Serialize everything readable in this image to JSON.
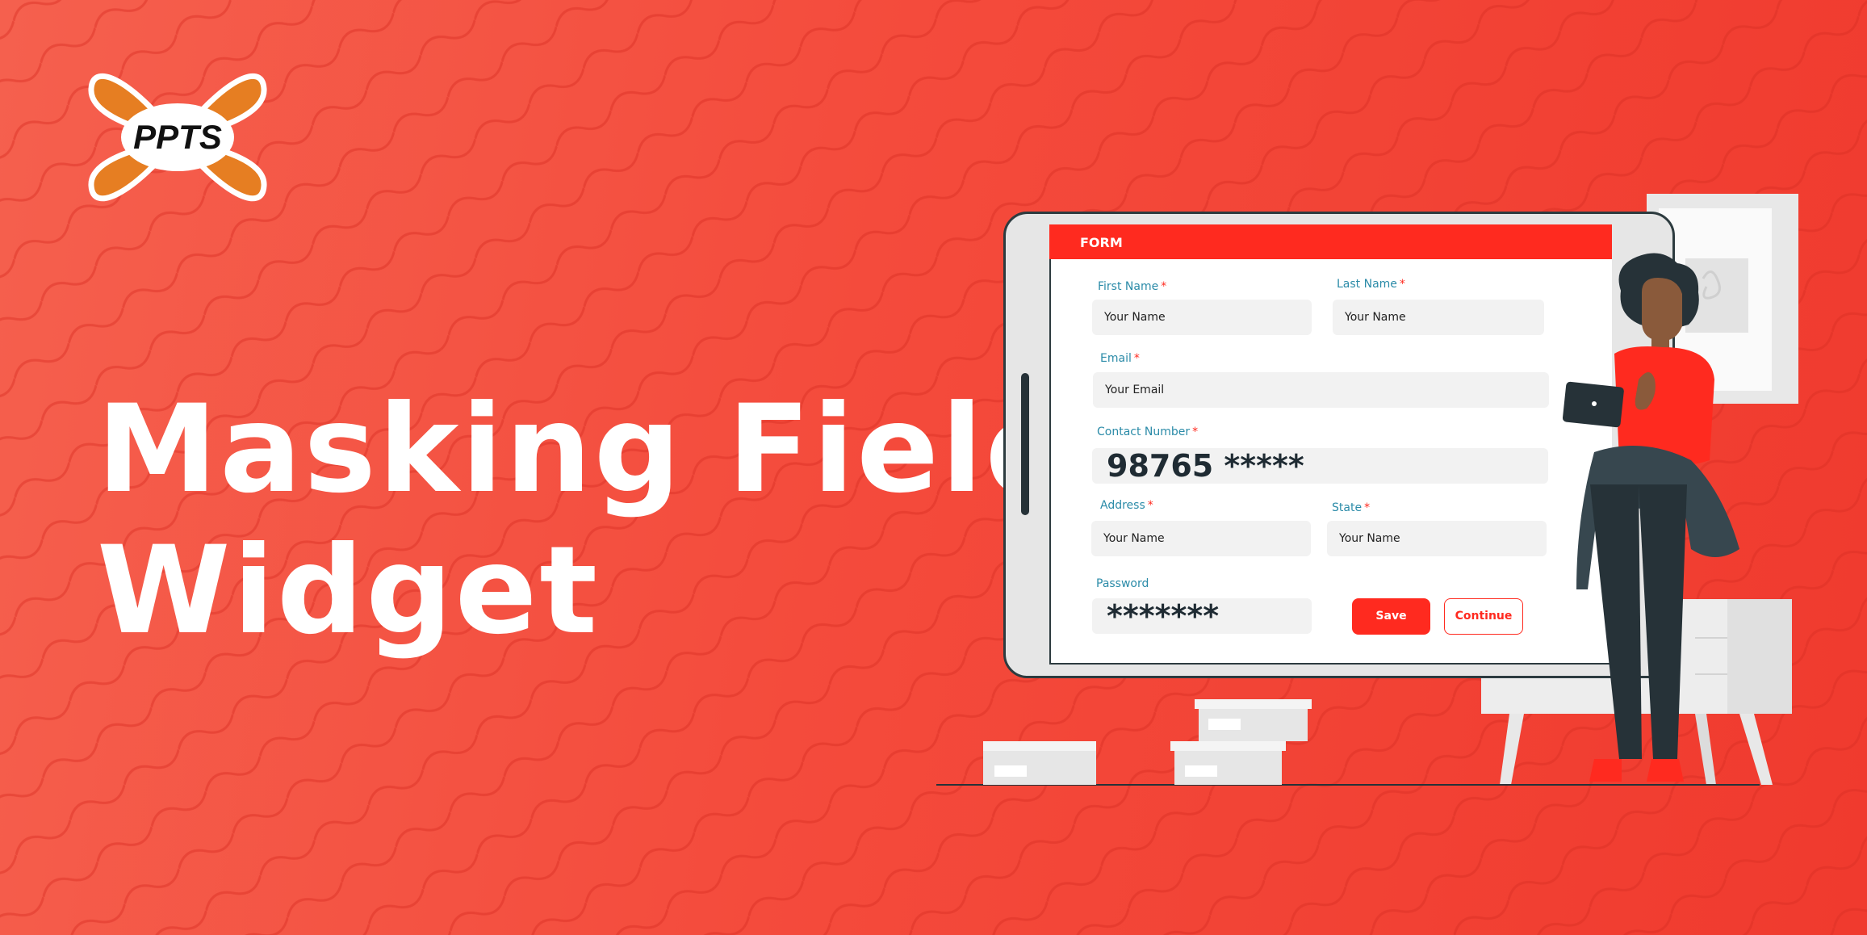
{
  "brand": {
    "logo_text": "PPTS",
    "logo_color": "#e67e22"
  },
  "headline": {
    "line1": "Masking Fields",
    "line2": "Widget"
  },
  "form": {
    "title": "FORM",
    "first_name": {
      "label": "First Name",
      "value": "Your Name"
    },
    "last_name": {
      "label": "Last Name",
      "value": "Your Name"
    },
    "email": {
      "label": "Email",
      "value": "Your Email"
    },
    "contact": {
      "label": "Contact  Number",
      "value": "98765 *****"
    },
    "address": {
      "label": "Address",
      "value": "Your Name"
    },
    "state": {
      "label": "State",
      "value": "Your Name"
    },
    "password": {
      "label": "Password",
      "value": "*******"
    },
    "required_mark": "*",
    "save_label": "Save",
    "continue_label": "Continue"
  },
  "colors": {
    "background": "#f44b3c",
    "accent": "#ff2a1f",
    "label": "#2b8ba8"
  },
  "icons": [
    "ppts-logo",
    "tablet-illustration",
    "person-illustration",
    "storage-boxes",
    "cabinet",
    "wall-frame"
  ]
}
